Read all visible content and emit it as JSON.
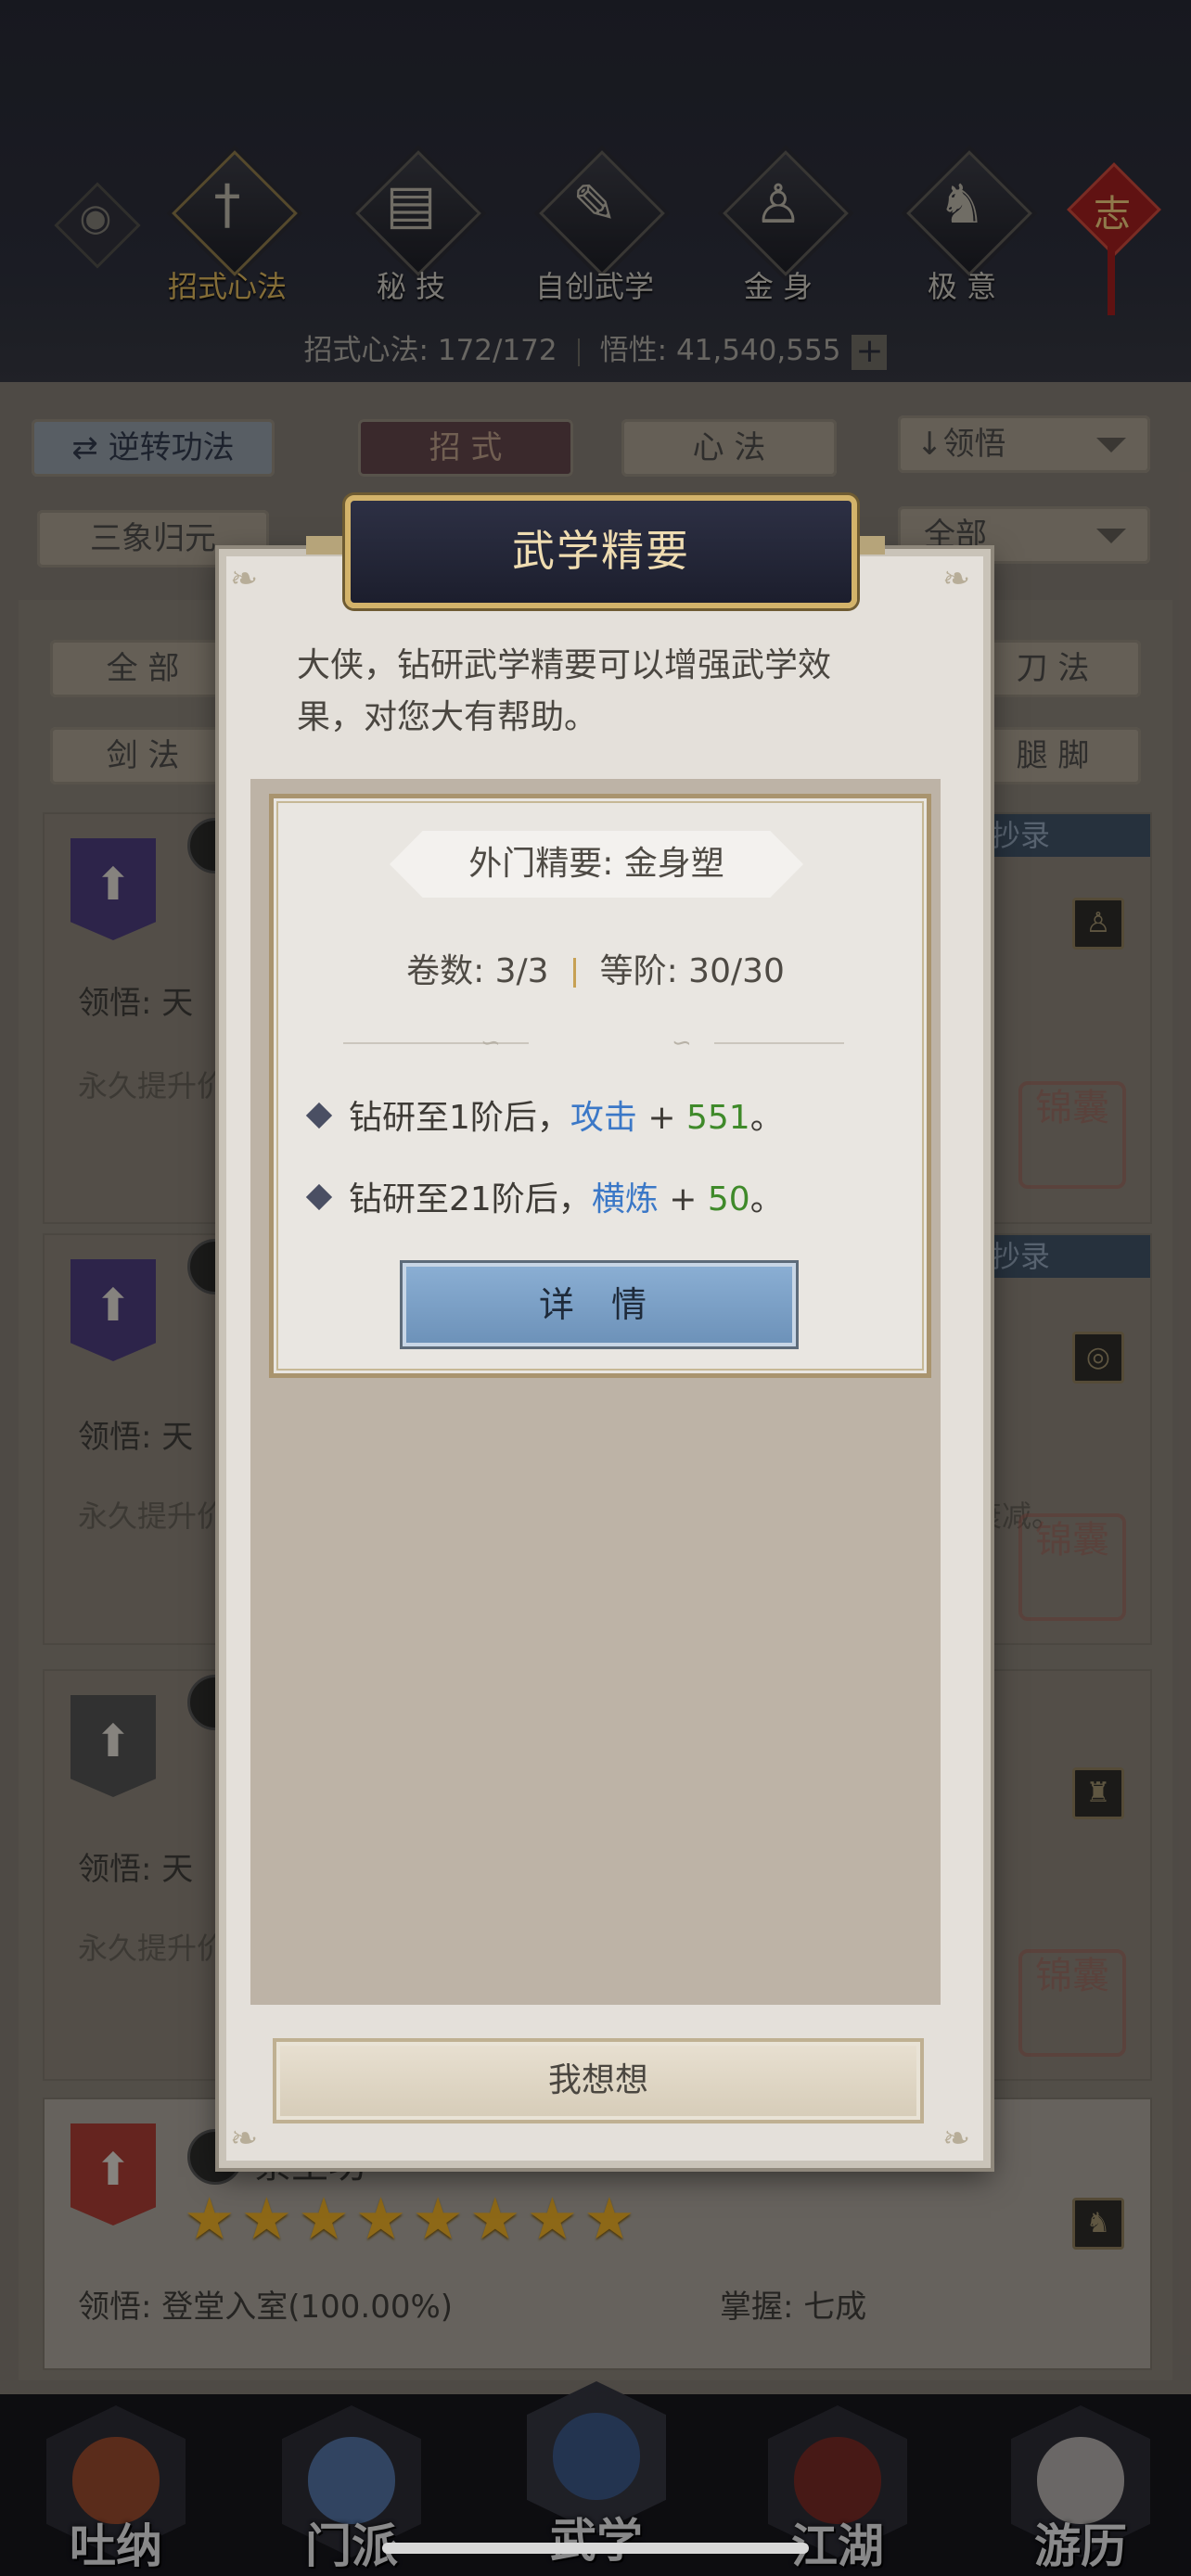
{
  "top_bar": {
    "tabs": [
      {
        "label": "招式心法",
        "icon": "sword-icon",
        "glyph": "†",
        "active": true
      },
      {
        "label": "秘 技",
        "icon": "book-icon",
        "glyph": "▤",
        "active": false
      },
      {
        "label": "自创武学",
        "icon": "scroll-icon",
        "glyph": "✎",
        "active": false
      },
      {
        "label": "金 身",
        "icon": "meditation-icon",
        "glyph": "♙",
        "active": false
      },
      {
        "label": "极 意",
        "icon": "figure-icon",
        "glyph": "♞",
        "active": false
      }
    ],
    "charm_text": "志",
    "stats": {
      "skills": "招式心法: 172/172",
      "insight": "悟性: 41,540,555",
      "plus": "+"
    }
  },
  "filters": {
    "reverse_button": "逆转功法",
    "reverse_icon": "⇄",
    "tab_moves": "招 式",
    "tab_methods": "心 法",
    "sort": "↓领悟",
    "sanxiang": "三象归元",
    "all_dropdown": "全部",
    "cat_all": "全 部",
    "cat_sword": "剑 法",
    "cat_blade": "刀 法",
    "cat_leg": "腿 脚"
  },
  "cards": [
    {
      "lead": "领悟: 天",
      "desc": "永久提升价",
      "ribbon": "阁已抄录",
      "seal": "锦囊"
    },
    {
      "lead": "领悟: 天",
      "desc": "永久提升价",
      "desc_right": "衰减。",
      "ribbon": "阁已抄录",
      "seal": "锦囊"
    },
    {
      "lead": "领悟: 天",
      "desc": "永久提升价",
      "seal": "锦囊"
    },
    {
      "name": "察生功",
      "lead": "领悟: 登堂入室(100.00%)",
      "mastery": "掌握: 七成",
      "star_count": 8
    }
  ],
  "dialog": {
    "title": "武学精要",
    "intro": "大侠，钻研武学精要可以增强武学效果，对您大有帮助。",
    "tag": "外门精要: 金身塑",
    "volumes": "卷数: 3/3",
    "rank": "等阶: 30/30",
    "bonuses": [
      {
        "prefix": "钻研至1阶后，",
        "stat": "攻击",
        "plus": " + ",
        "value": "551",
        "suffix": "。"
      },
      {
        "prefix": "钻研至21阶后，",
        "stat": "横炼",
        "plus": " + ",
        "value": "50",
        "suffix": "。"
      }
    ],
    "detail_button": "详 情",
    "think_button": "我想想"
  },
  "bottom_nav": [
    {
      "label": "吐纳",
      "color": "#b4522b"
    },
    {
      "label": "门派",
      "color": "#5c86c2"
    },
    {
      "label": "武学",
      "color": "#3c5f9a"
    },
    {
      "label": "江湖",
      "color": "#8c2a22"
    },
    {
      "label": "游历",
      "color": "#d7d2cc"
    }
  ],
  "colors": {
    "stat_blue": "#3b78c7",
    "value_green": "#3f8a2a",
    "gold": "#d6b05a"
  }
}
